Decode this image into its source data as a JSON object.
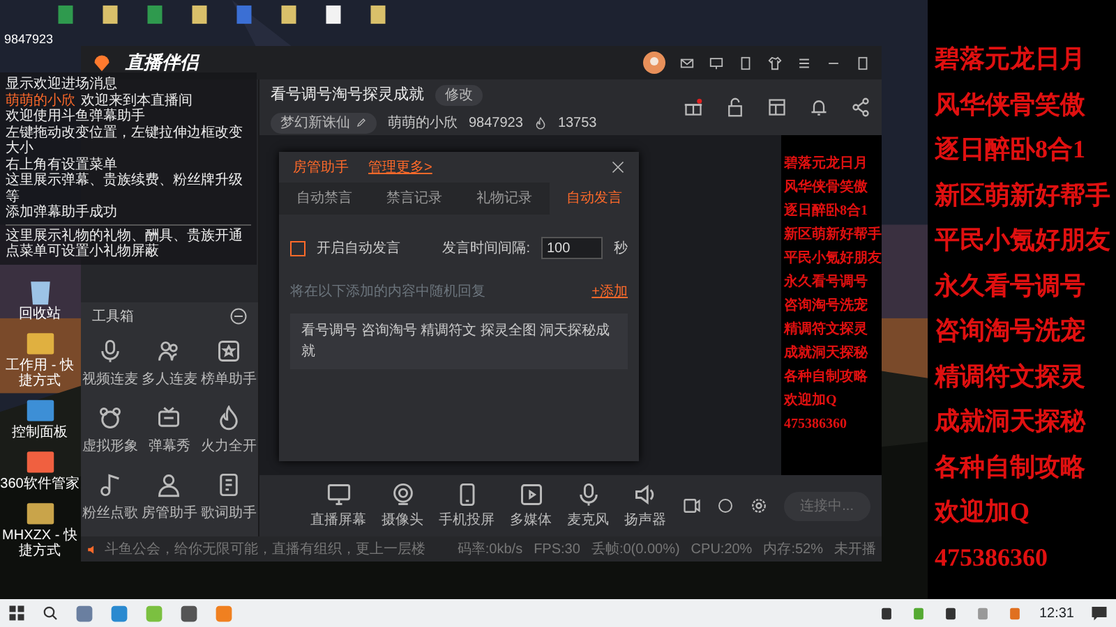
{
  "desktop": {
    "icons": [
      {
        "label": "回收站"
      },
      {
        "label": "工作用 - 快捷方式"
      },
      {
        "label": "控制面板"
      },
      {
        "label": "360软件管家"
      },
      {
        "label": "MHXZX - 快捷方式"
      }
    ]
  },
  "overlay_id": "9847923",
  "chat_overlay": {
    "lines": [
      {
        "kind": "plain",
        "text": "显示欢迎进场消息"
      },
      {
        "kind": "welcome",
        "user": "萌萌的小欣",
        "text": "欢迎来到本直播间"
      },
      {
        "kind": "plain",
        "text": "欢迎使用斗鱼弹幕助手"
      },
      {
        "kind": "plain",
        "text": "左键拖动改变位置，左键拉伸边框改变大小"
      },
      {
        "kind": "plain",
        "text": "右上角有设置菜单"
      },
      {
        "kind": "plain",
        "text": "这里展示弹幕、贵族续费、粉丝牌升级等"
      },
      {
        "kind": "plain",
        "text": "添加弹幕助手成功"
      },
      {
        "kind": "divider"
      },
      {
        "kind": "plain",
        "text": "这里展示礼物的礼物、酬具、贵族开通"
      },
      {
        "kind": "plain",
        "text": "点菜单可设置小礼物屏蔽"
      }
    ]
  },
  "app": {
    "logo": "直播伴侣",
    "toolbox": {
      "title": "工具箱",
      "tools": [
        {
          "label": "视频连麦"
        },
        {
          "label": "多人连麦"
        },
        {
          "label": "榜单助手"
        },
        {
          "label": "虚拟形象"
        },
        {
          "label": "弹幕秀"
        },
        {
          "label": "火力全开"
        },
        {
          "label": "粉丝点歌"
        },
        {
          "label": "房管助手"
        },
        {
          "label": "歌词助手"
        }
      ]
    },
    "room": {
      "title": "看号调号淘号探灵成就",
      "edit_button": "修改",
      "category": "梦幻新诛仙",
      "streamer": "萌萌的小欣",
      "room_id": "9847923",
      "heat": "13753"
    },
    "dialog": {
      "title": "房管助手",
      "more_link": "管理更多>",
      "tabs": [
        {
          "label": "自动禁言",
          "selected": false
        },
        {
          "label": "禁言记录",
          "selected": false
        },
        {
          "label": "礼物记录",
          "selected": false
        },
        {
          "label": "自动发言",
          "selected": true
        }
      ],
      "auto_speak": {
        "label": "开启自动发言",
        "checked": false
      },
      "interval_label": "发言时间间隔:",
      "interval_value": "100",
      "interval_unit": "秒",
      "hint": "将在以下添加的内容中随机回复",
      "add_link": "+添加",
      "message": "看号调号 咨询淘号 精调符文 探灵全图 洞天探秘成就"
    },
    "preview_lines": [
      "碧落元龙日月",
      "风华侠骨笑傲",
      "逐日醉卧8合1",
      "新区萌新好帮手",
      "平民小氪好朋友",
      "永久看号调号",
      "咨询淘号洗宠",
      "精调符文探灵",
      "成就洞天探秘",
      "各种自制攻略",
      "欢迎加Q",
      "475386360"
    ],
    "toolbar": [
      {
        "label": "直播屏幕"
      },
      {
        "label": "摄像头"
      },
      {
        "label": "手机投屏"
      },
      {
        "label": "多媒体"
      },
      {
        "label": "麦克风"
      },
      {
        "label": "扬声器"
      }
    ],
    "connect_button": {
      "label": "连接中...",
      "disabled": true
    },
    "status_bar": {
      "notice": "斗鱼公会，给你无限可能，直播有组织，更上一层楼",
      "stats": [
        "码率:0kb/s",
        "FPS:30",
        "丢帧:0(0.00%)",
        "CPU:20%",
        "内存:52%",
        "未开播"
      ]
    }
  },
  "promo_lines": [
    "碧落元龙日月",
    "风华侠骨笑傲",
    "逐日醉卧8合1",
    "新区萌新好帮手",
    "平民小氪好朋友",
    "永久看号调号",
    "咨询淘号洗宠",
    "精调符文探灵",
    "成就洞天探秘",
    "各种自制攻略",
    "欢迎加Q",
    "475386360"
  ],
  "taskbar": {
    "time": "12:31"
  }
}
